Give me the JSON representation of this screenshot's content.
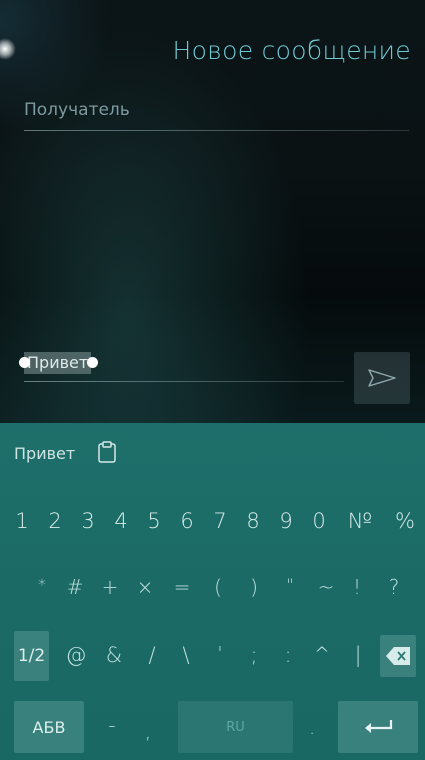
{
  "header": {
    "title": "Новое сообщение"
  },
  "recipient": {
    "placeholder": "Получатель"
  },
  "message": {
    "text": "Привет"
  },
  "keyboard": {
    "suggestion": "Привет",
    "row1": [
      "1",
      "2",
      "3",
      "4",
      "5",
      "6",
      "7",
      "8",
      "9",
      "0",
      "№",
      "%"
    ],
    "row2": [
      "*",
      "#",
      "+",
      "×",
      "=",
      "(",
      ")",
      "\"",
      "~",
      "!",
      "?"
    ],
    "row3": [
      "@",
      "&",
      "/",
      "\\",
      "'",
      ";",
      ":",
      "^",
      "|"
    ],
    "page_label": "1/2",
    "letters_label": "АБВ",
    "dash": "-",
    "comma": ",",
    "space_label": "RU",
    "dot": "."
  },
  "colors": {
    "accent": "#6fc9d3",
    "keyboard_bg": "#1d6d69"
  }
}
